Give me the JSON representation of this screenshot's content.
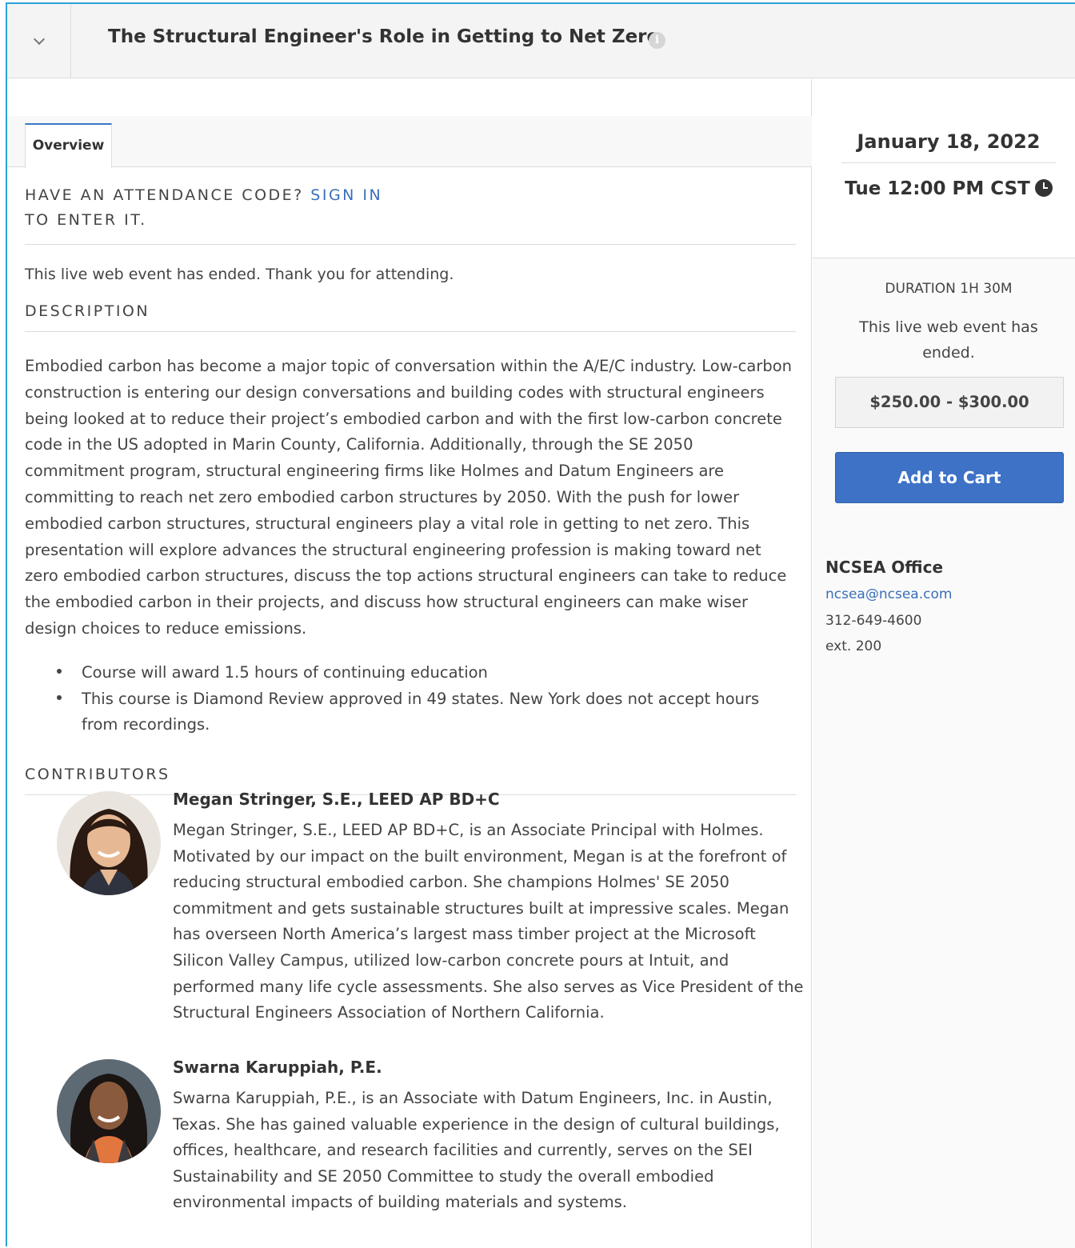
{
  "header": {
    "title": "The Structural Engineer's Role in Getting to Net Zero",
    "info_glyph": "i"
  },
  "tabs": [
    {
      "label": "Overview",
      "active": true
    }
  ],
  "attendance": {
    "prefix": "HAVE AN ATTENDANCE CODE?",
    "link": "SIGN IN",
    "suffix": "TO ENTER IT."
  },
  "status_message": "This live web event has ended. Thank you for attending.",
  "description": {
    "heading": "DESCRIPTION",
    "text": "Embodied carbon has become a major topic of conversation within the A/E/C industry. Low-carbon construction is entering our design conversations and building codes with structural engineers being looked at to reduce their project’s embodied carbon and with the first low-carbon concrete code in the US adopted in Marin County, California. Additionally, through the SE 2050 commitment program, structural engineering firms like Holmes and Datum Engineers are committing to reach net zero embodied carbon structures by 2050. With the push for lower embodied carbon structures, structural engineers play a vital role in getting to net zero. This presentation will explore advances the structural engineering profession is making toward net zero embodied carbon structures, discuss the top actions structural engineers can take to reduce the embodied carbon in their projects, and discuss how structural engineers can make wiser design choices to reduce emissions.",
    "bullets": [
      "Course will award 1.5 hours of continuing education",
      "This course is Diamond Review approved in 49 states. New York does not accept hours from recordings."
    ]
  },
  "contributors": {
    "heading": "CONTRIBUTORS",
    "people": [
      {
        "name": "Megan Stringer, S.E., LEED AP BD+C",
        "bio": "Megan Stringer, S.E., LEED AP BD+C, is an Associate Principal with Holmes. Motivated by our impact on the built environment, Megan is at the forefront of reducing structural embodied carbon. She champions Holmes' SE 2050 commitment and gets sustainable structures built at impressive scales. Megan has overseen North America’s largest mass timber project at the Microsoft Silicon Valley Campus, utilized low-carbon concrete pours at Intuit, and performed many life cycle assessments. She also serves as Vice President of the Structural Engineers Association of Northern California."
      },
      {
        "name": "Swarna Karuppiah, P.E.",
        "bio": "Swarna Karuppiah, P.E., is an Associate with Datum Engineers, Inc. in Austin, Texas. She has gained valuable experience in the design of cultural buildings, offices, healthcare, and research facilities and currently, serves on the SEI Sustainability and SE 2050 Committee to study the overall embodied environmental impacts of building materials and systems."
      }
    ]
  },
  "sidebar": {
    "date": "January 18, 2022",
    "time": "Tue 12:00 PM CST",
    "duration": "DURATION 1H 30M",
    "ended": "This live web event has ended.",
    "price": "$250.00 - $300.00",
    "cart_label": "Add to Cart",
    "contact": {
      "name": "NCSEA Office",
      "email": "ncsea@ncsea.com",
      "phone": "312-649-4600",
      "ext": "ext. 200"
    }
  },
  "colors": {
    "accent": "#3d72c6",
    "link": "#3a6fb8",
    "frame": "#2ba3d8"
  },
  "icons": {
    "toggle": "chevron-down-icon",
    "info": "info-icon",
    "clock": "clock-icon"
  }
}
